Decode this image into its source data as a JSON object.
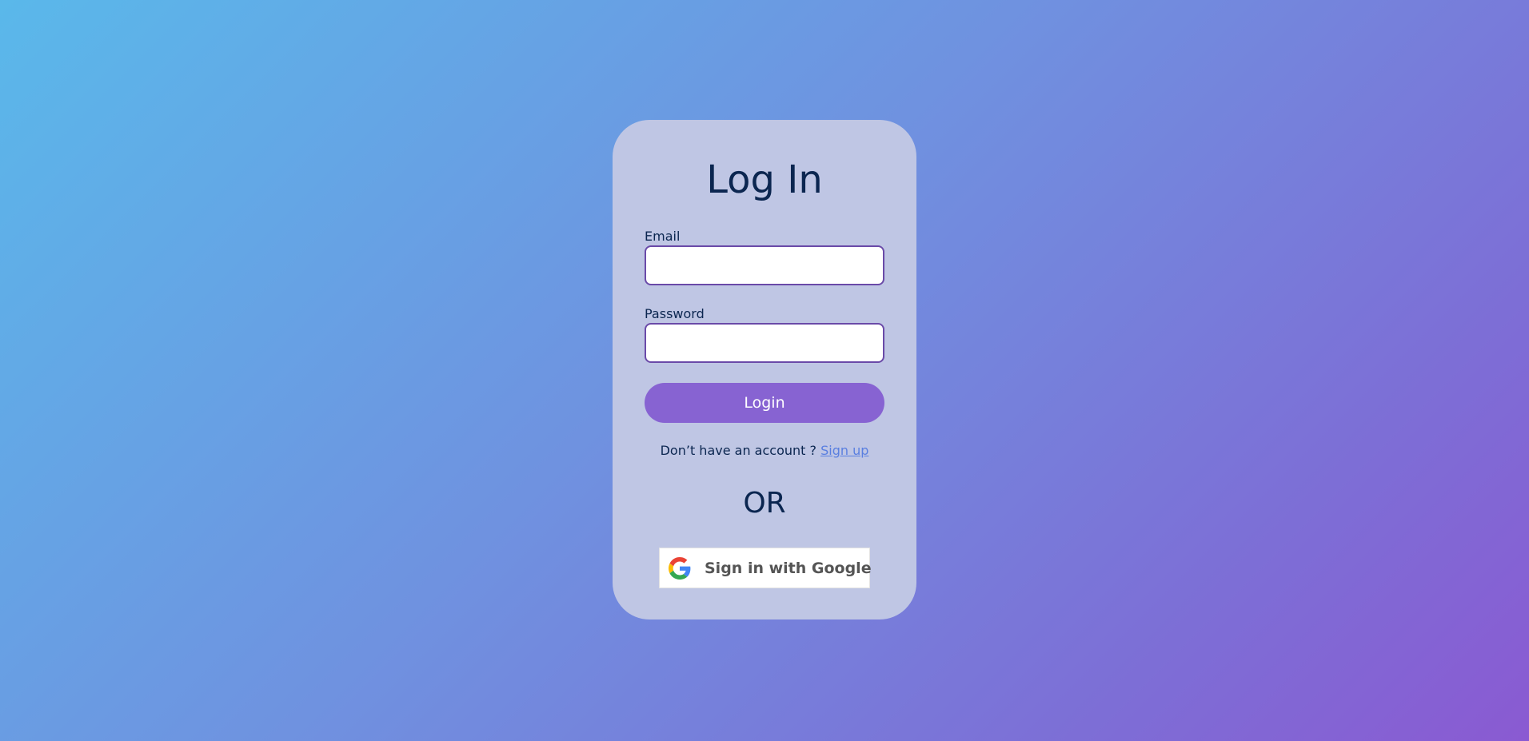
{
  "login": {
    "title": "Log In",
    "email_label": "Email",
    "email_value": "",
    "password_label": "Password",
    "password_value": "",
    "login_button": "Login",
    "signup_prompt": "Don’t have an account ? ",
    "signup_link": "Sign up",
    "divider_text": "OR",
    "google_button": "Sign in with Google",
    "google_icon": "google-g-icon"
  },
  "colors": {
    "background_start": "#5ab8ea",
    "background_end": "#8a5ad2",
    "card": "#bfc6e4",
    "text": "#0b2650",
    "accent": "#8763d2",
    "link": "#5a7fe0",
    "input_border": "#6a4aa8"
  }
}
